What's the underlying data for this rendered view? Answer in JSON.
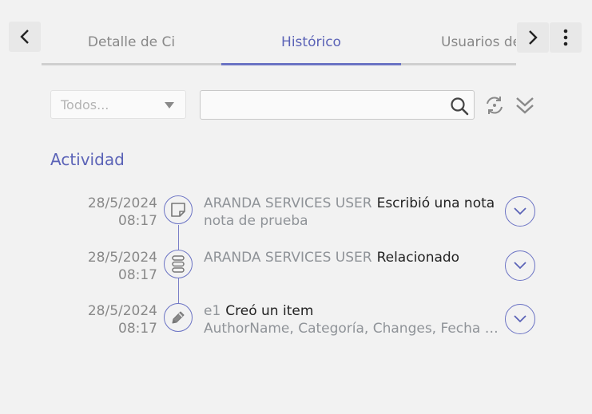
{
  "tabs": [
    {
      "label": "Detalle de Ci"
    },
    {
      "label": "Histórico"
    },
    {
      "label": "Usuarios de"
    }
  ],
  "filter": {
    "placeholder": "Todos..."
  },
  "search": {
    "value": ""
  },
  "section_title": "Actividad",
  "entries": [
    {
      "date": "28/5/2024",
      "time": "08:17",
      "user": "ARANDA SERVICES USER",
      "action": "Escribió una nota",
      "detail": "nota de prueba",
      "icon": "note-icon"
    },
    {
      "date": "28/5/2024",
      "time": "08:17",
      "user": "ARANDA SERVICES USER",
      "action": "Relacionado",
      "detail": "",
      "icon": "relation-icon"
    },
    {
      "date": "28/5/2024",
      "time": "08:17",
      "user": "e1",
      "action": "Creó un item",
      "detail": "AuthorName, Categoría, Changes, Fecha de",
      "icon": "pencil-icon"
    }
  ],
  "colors": {
    "accent": "#5b63b7",
    "muted": "#888888",
    "background": "#f2f2f2"
  }
}
